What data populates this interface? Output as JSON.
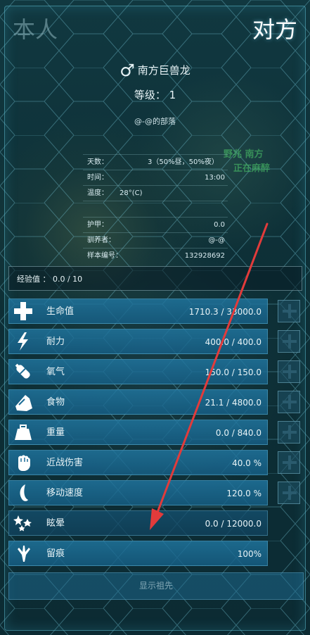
{
  "tabs": {
    "self": "本人",
    "other": "对方"
  },
  "creature": {
    "gender_symbol": "♂",
    "name": "南方巨兽龙"
  },
  "level": {
    "label": "等级：",
    "value": "1"
  },
  "tribe": "@-@的部落",
  "info_top": [
    {
      "label": "天数：",
      "value": "3（50%昼，50%夜）"
    },
    {
      "label": "时间：",
      "value": "13:00"
    },
    {
      "label": "温度：",
      "value": "28°(C)"
    }
  ],
  "info_bottom": [
    {
      "label": "护甲：",
      "value": "0.0"
    },
    {
      "label": "驯养者：",
      "value": "@-@"
    },
    {
      "label": "样本编号：",
      "value": "132928692"
    }
  ],
  "background_text": {
    "line1": "野兆 南方",
    "line2": "正在麻醉"
  },
  "xp": {
    "label": "经验值 ： 0.0 / 10"
  },
  "stats": [
    {
      "name": "生命值",
      "value": "1710.3  /  33000.0",
      "icon": "health-cross-icon"
    },
    {
      "name": "耐力",
      "value": "400.0  /  400.0",
      "icon": "stamina-lightning-icon"
    },
    {
      "name": "氧气",
      "value": "150.0  /  150.0",
      "icon": "oxygen-tank-icon"
    },
    {
      "name": "食物",
      "value": "21.1  /  4800.0",
      "icon": "food-bag-icon"
    },
    {
      "name": "重量",
      "value": "0.0  /  840.0",
      "icon": "weight-icon"
    },
    {
      "name": "近战伤害",
      "value": "40.0  %",
      "icon": "fist-icon"
    },
    {
      "name": "移动速度",
      "value": "120.0  %",
      "icon": "speed-foot-icon"
    },
    {
      "name": "眩晕",
      "value": "0.0  /  12000.0",
      "icon": "torpor-stars-icon"
    },
    {
      "name": "留痕",
      "value": "100%",
      "icon": "footprint-icon"
    }
  ],
  "ancestors_button": "显示祖先",
  "colors": {
    "stat_bar": "#1f6f98",
    "annotation_arrow": "#e23b3b",
    "panel_border": "#5cbed2"
  }
}
